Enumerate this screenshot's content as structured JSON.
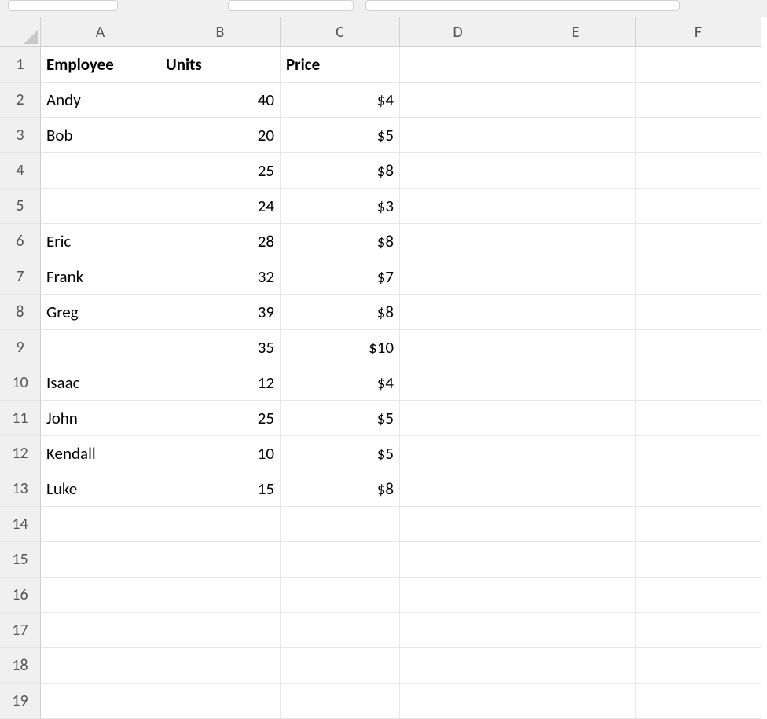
{
  "columns": [
    "A",
    "B",
    "C",
    "D",
    "E",
    "F"
  ],
  "row_numbers": [
    "1",
    "2",
    "3",
    "4",
    "5",
    "6",
    "7",
    "8",
    "9",
    "10",
    "11",
    "12",
    "13",
    "14",
    "15",
    "16",
    "17",
    "18",
    "19"
  ],
  "headers": {
    "employee": "Employee",
    "units": "Units",
    "price": "Price"
  },
  "rows": [
    {
      "employee": "Andy",
      "units": "40",
      "price": "$4"
    },
    {
      "employee": "Bob",
      "units": "20",
      "price": "$5"
    },
    {
      "employee": "",
      "units": "25",
      "price": "$8"
    },
    {
      "employee": "",
      "units": "24",
      "price": "$3"
    },
    {
      "employee": "Eric",
      "units": "28",
      "price": "$8"
    },
    {
      "employee": "Frank",
      "units": "32",
      "price": "$7"
    },
    {
      "employee": "Greg",
      "units": "39",
      "price": "$8"
    },
    {
      "employee": "",
      "units": "35",
      "price": "$10"
    },
    {
      "employee": "Isaac",
      "units": "12",
      "price": "$4"
    },
    {
      "employee": "John",
      "units": "25",
      "price": "$5"
    },
    {
      "employee": "Kendall",
      "units": "10",
      "price": "$5"
    },
    {
      "employee": "Luke",
      "units": "15",
      "price": "$8"
    }
  ],
  "total_rows": 19
}
